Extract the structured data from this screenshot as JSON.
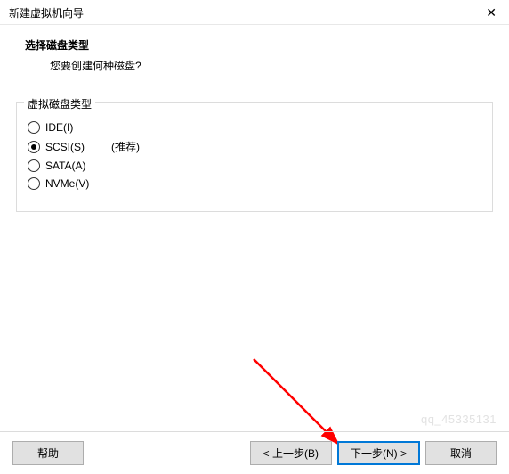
{
  "titlebar": {
    "title": "新建虚拟机向导",
    "close": "✕"
  },
  "header": {
    "title": "选择磁盘类型",
    "subtitle": "您要创建何种磁盘?"
  },
  "fieldset": {
    "legend": "虚拟磁盘类型",
    "options": {
      "ide": {
        "label": "IDE(I)",
        "checked": false
      },
      "scsi": {
        "label": "SCSI(S)",
        "checked": true,
        "recommend": "(推荐)"
      },
      "sata": {
        "label": "SATA(A)",
        "checked": false
      },
      "nvme": {
        "label": "NVMe(V)",
        "checked": false
      }
    }
  },
  "footer": {
    "help": "帮助",
    "back": "< 上一步(B)",
    "next": "下一步(N) >",
    "cancel": "取消"
  },
  "watermark": "qq_45335131"
}
